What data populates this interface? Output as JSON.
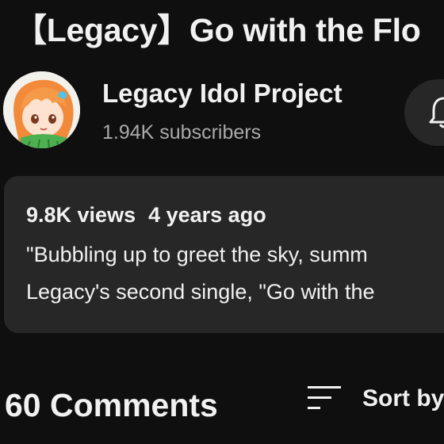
{
  "video": {
    "title": "【Legacy】Go with the Flo"
  },
  "channel": {
    "name": "Legacy Idol Project",
    "subscribers": "1.94K subscribers",
    "avatar_icon": "anime-character-avatar",
    "bell_icon": "bell-icon"
  },
  "description": {
    "views": "9.8K views",
    "age": "4 years ago",
    "line1": "\"Bubbling up to greet the sky, summ",
    "line2": "Legacy's second single, \"Go with the"
  },
  "comments": {
    "count_label": "60 Comments",
    "sort_label": "Sort by",
    "sort_icon": "sort-icon"
  },
  "colors": {
    "background": "#0f0f0f",
    "surface": "#272727",
    "text_primary": "#f1f1f1",
    "text_secondary": "#aaaaaa"
  }
}
